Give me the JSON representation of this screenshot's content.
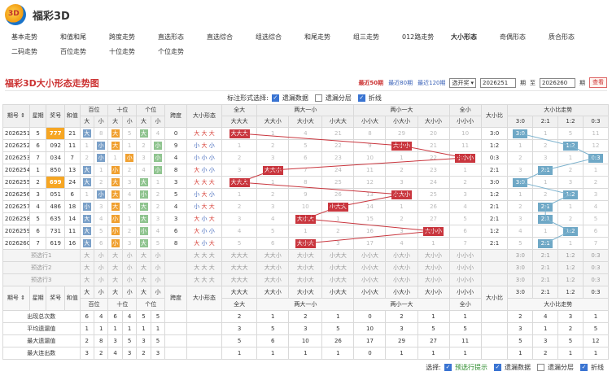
{
  "app": {
    "title": "福彩3D",
    "logo_text": "3D"
  },
  "nav": {
    "row1": [
      "基本走势",
      "和值和尾",
      "跨度走势",
      "直选形态",
      "直选综合",
      "组选综合",
      "和尾走势",
      "组三走势",
      "012路走势",
      "大小形态",
      "奇偶形态",
      "质合形态"
    ],
    "row2": [
      "二码走势",
      "百位走势",
      "十位走势",
      "个位走势"
    ],
    "active": "大小形态"
  },
  "chart": {
    "title": "福彩3D大小形态走势图",
    "filters": [
      "最近50期",
      "最近80期",
      "最近120期"
    ],
    "active_filter": "最近50期",
    "select_label": "选开奖",
    "from_value": "2026251",
    "from_unit": "期",
    "to_label": "至",
    "to_value": "2026260",
    "to_unit": "期",
    "query_label": "查看"
  },
  "marker": {
    "label": "标注形式选择:",
    "options": [
      {
        "label": "遗漏数据",
        "checked": true
      },
      {
        "label": "遗漏分层",
        "checked": false
      },
      {
        "label": "折线",
        "checked": true
      }
    ]
  },
  "headers": {
    "issue": "期号",
    "week": "星期",
    "prize": "奖号",
    "sum": "和值",
    "pos": [
      "百位",
      "十位",
      "个位"
    ],
    "big": "大",
    "small": "小",
    "span": "跨度",
    "shape": "大小形态",
    "groups": [
      "全大",
      "两大一小",
      "两小一大",
      "全小"
    ],
    "patterns": [
      "大大大",
      "大大小",
      "大小大",
      "小大大",
      "小小大",
      "小大小",
      "大小小",
      "小小小"
    ],
    "ratio": "大小比",
    "ratio_trend": "大小比走势",
    "ratio_cols": [
      "3:0",
      "2:1",
      "1:2",
      "0:3"
    ]
  },
  "rows": [
    {
      "issue": "2026251",
      "week": "5",
      "prize": "777",
      "sum": "21",
      "pos": [
        "大",
        8,
        "大",
        5,
        "大",
        4
      ],
      "span": "0",
      "shape": [
        "大",
        "大",
        "大"
      ],
      "pat": [
        "大大大",
        "1",
        "4",
        "21",
        "8",
        "29",
        "20",
        "10"
      ],
      "hit": 0,
      "ratio": "3:0",
      "rt": [
        "3:0",
        "1",
        "5",
        "11"
      ],
      "rhit": 0,
      "gold": true
    },
    {
      "issue": "2026252",
      "week": "6",
      "prize": "092",
      "sum": "11",
      "pos": [
        1,
        "小",
        "大",
        1,
        2,
        "小"
      ],
      "span": "9",
      "shape": [
        "小",
        "大",
        "小"
      ],
      "pat": [
        "1",
        "2",
        "5",
        "22",
        "9",
        "大小小",
        "21",
        "11"
      ],
      "hit": 5,
      "ratio": "1:2",
      "rt": [
        "1",
        "2",
        "1:2",
        "12"
      ],
      "rhit": 2,
      "gold": false
    },
    {
      "issue": "2026253",
      "week": "7",
      "prize": "034",
      "sum": "7",
      "pos": [
        2,
        "小",
        1,
        "小",
        3,
        "小"
      ],
      "span": "4",
      "shape": [
        "小",
        "小",
        "小"
      ],
      "pat": [
        "2",
        "3",
        "6",
        "23",
        "10",
        "1",
        "22",
        "小小小"
      ],
      "hit": 7,
      "ratio": "0:3",
      "rt": [
        "2",
        "3",
        "1",
        "0:3"
      ],
      "rhit": 3,
      "gold": false
    },
    {
      "issue": "2026254",
      "week": "1",
      "prize": "850",
      "sum": "13",
      "pos": [
        "大",
        1,
        "小",
        2,
        4,
        "小"
      ],
      "span": "8",
      "shape": [
        "大",
        "小",
        "小"
      ],
      "pat": [
        "3",
        "大大小",
        "7",
        "24",
        "11",
        "2",
        "23",
        "1"
      ],
      "hit": 1,
      "ratio": "2:1",
      "rt": [
        "3",
        "2:1",
        "2",
        "1"
      ],
      "rhit": 1,
      "gold": false
    },
    {
      "issue": "2026255",
      "week": "2",
      "prize": "699",
      "sum": "24",
      "pos": [
        "大",
        2,
        "大",
        3,
        "大",
        1
      ],
      "span": "3",
      "shape": [
        "大",
        "大",
        "大"
      ],
      "pat": [
        "大大大",
        "1",
        "8",
        "25",
        "12",
        "3",
        "24",
        "2"
      ],
      "hit": 0,
      "ratio": "3:0",
      "rt": [
        "3:0",
        "1",
        "3",
        "2"
      ],
      "rhit": 0,
      "gold": true
    },
    {
      "issue": "2026256",
      "week": "3",
      "prize": "051",
      "sum": "6",
      "pos": [
        1,
        "小",
        "大",
        4,
        "小",
        2
      ],
      "span": "5",
      "shape": [
        "小",
        "大",
        "小"
      ],
      "pat": [
        "1",
        "2",
        "9",
        "26",
        "13",
        "小大小",
        "25",
        "3"
      ],
      "hit": 5,
      "ratio": "1:2",
      "rt": [
        "1",
        "2",
        "1:2",
        "3"
      ],
      "rhit": 2,
      "gold": false
    },
    {
      "issue": "2026257",
      "week": "4",
      "prize": "486",
      "sum": "18",
      "pos": [
        "小",
        3,
        "大",
        5,
        "大",
        2
      ],
      "span": "4",
      "shape": [
        "小",
        "大",
        "大"
      ],
      "pat": [
        "2",
        "3",
        "10",
        "小大大",
        "14",
        "1",
        "26",
        "4"
      ],
      "hit": 3,
      "ratio": "2:1",
      "rt": [
        "2",
        "2:1",
        "1",
        "4"
      ],
      "rhit": 1,
      "gold": false
    },
    {
      "issue": "2026258",
      "week": "5",
      "prize": "635",
      "sum": "14",
      "pos": [
        "大",
        4,
        "小",
        1,
        "大",
        3
      ],
      "span": "3",
      "shape": [
        "大",
        "小",
        "大"
      ],
      "pat": [
        "3",
        "4",
        "大小大",
        "1",
        "15",
        "2",
        "27",
        "5"
      ],
      "hit": 2,
      "ratio": "2:1",
      "rt": [
        "3",
        "2:1",
        "2",
        "5"
      ],
      "rhit": 1,
      "gold": false
    },
    {
      "issue": "2026259",
      "week": "6",
      "prize": "731",
      "sum": "11",
      "pos": [
        "大",
        5,
        "小",
        2,
        "小",
        4
      ],
      "span": "6",
      "shape": [
        "大",
        "小",
        "小"
      ],
      "pat": [
        "4",
        "5",
        "1",
        "2",
        "16",
        "3",
        "大小小",
        "6"
      ],
      "hit": 6,
      "ratio": "1:2",
      "rt": [
        "4",
        "1",
        "1:2",
        "6"
      ],
      "rhit": 2,
      "gold": false
    },
    {
      "issue": "2026260",
      "week": "7",
      "prize": "619",
      "sum": "16",
      "pos": [
        "大",
        6,
        "小",
        3,
        "大",
        5
      ],
      "span": "8",
      "shape": [
        "大",
        "小",
        "大"
      ],
      "pat": [
        "5",
        "6",
        "大小大",
        "3",
        "17",
        "4",
        "1",
        "7"
      ],
      "hit": 2,
      "ratio": "2:1",
      "rt": [
        "5",
        "2:1",
        "1",
        "7"
      ],
      "rhit": 1,
      "gold": false
    }
  ],
  "preselect": {
    "labels": [
      "预选行1",
      "预选行2",
      "预选行3"
    ],
    "pos": [
      "大",
      "小",
      "大",
      "小",
      "大",
      "小"
    ],
    "shape": [
      "大",
      "大",
      "大"
    ],
    "ratio_cols": [
      "3:0",
      "2:1",
      "1:2",
      "0:3"
    ]
  },
  "stats": [
    {
      "label": "出现总次数",
      "pos": [
        "6",
        "4",
        "6",
        "4",
        "5",
        "5"
      ],
      "pat": [
        "2",
        "1",
        "2",
        "1",
        "0",
        "2",
        "1",
        "1"
      ],
      "rt": [
        "2",
        "4",
        "3",
        "1"
      ]
    },
    {
      "label": "平均遗漏值",
      "pos": [
        "1",
        "1",
        "1",
        "1",
        "1",
        "1"
      ],
      "pat": [
        "3",
        "5",
        "3",
        "5",
        "10",
        "3",
        "5",
        "5"
      ],
      "rt": [
        "3",
        "1",
        "2",
        "5"
      ]
    },
    {
      "label": "最大遗漏值",
      "pos": [
        "2",
        "8",
        "3",
        "5",
        "3",
        "5"
      ],
      "pat": [
        "5",
        "6",
        "10",
        "26",
        "17",
        "29",
        "27",
        "11"
      ],
      "rt": [
        "5",
        "3",
        "5",
        "12"
      ]
    },
    {
      "label": "最大连出数",
      "pos": [
        "3",
        "2",
        "4",
        "3",
        "2",
        "3"
      ],
      "pat": [
        "1",
        "1",
        "1",
        "1",
        "0",
        "1",
        "1",
        "1"
      ],
      "rt": [
        "1",
        "2",
        "1",
        "1"
      ]
    }
  ],
  "options": {
    "label": "选择:",
    "items": [
      {
        "label": "预选行提示",
        "checked": true,
        "accent": true
      },
      {
        "label": "遗漏数据",
        "checked": true
      },
      {
        "label": "遗漏分层",
        "checked": false
      },
      {
        "label": "折线",
        "checked": true
      }
    ]
  }
}
